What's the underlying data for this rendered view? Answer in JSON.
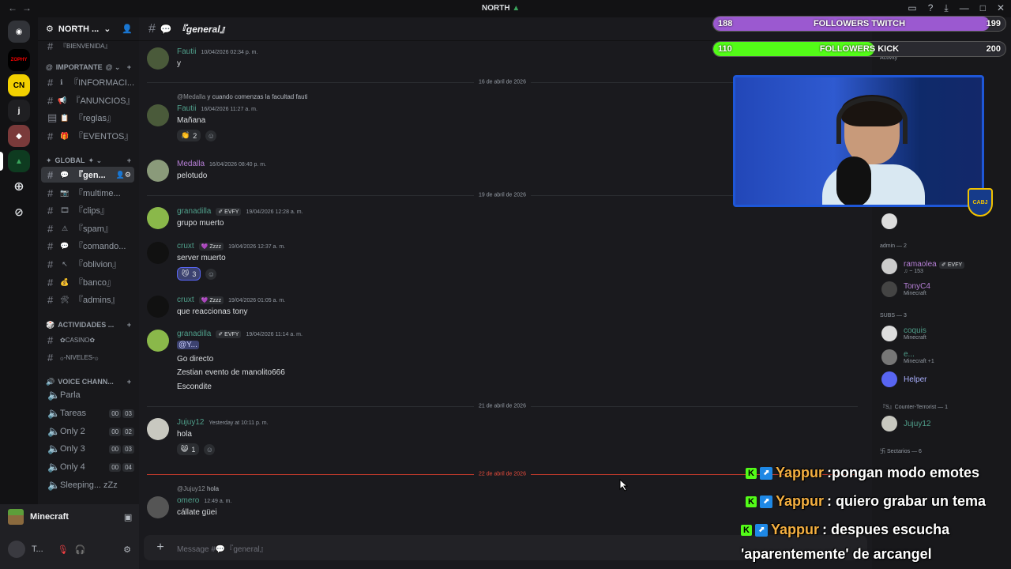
{
  "titlebar": {
    "title": "NORTH",
    "leaf": "▲"
  },
  "server": {
    "name": "NORTH ...",
    "categories": {
      "importante": "IMPORTANTE",
      "global": "GLOBAL",
      "actividades": "ACTIVIDADES ...",
      "voice": "VOICE CHANN..."
    },
    "top_channel": "『BIENVENIDA』",
    "channels_importante": [
      {
        "label": "『INFORMACI...",
        "emoji": "ℹ"
      },
      {
        "label": "『ANUNCIOS』",
        "emoji": "📢"
      },
      {
        "label": "『reglas』",
        "emoji": "📋"
      },
      {
        "label": "『EVENTOS』",
        "emoji": "🎁"
      }
    ],
    "channels_global": [
      {
        "label": "『gen...",
        "emoji": "💬"
      },
      {
        "label": "『multime...",
        "emoji": "📷"
      },
      {
        "label": "『clips』",
        "emoji": "🎞"
      },
      {
        "label": "『spam』",
        "emoji": "⚠"
      },
      {
        "label": "『comando...",
        "emoji": "💬"
      },
      {
        "label": "『oblivion』",
        "emoji": "↖"
      },
      {
        "label": "『banco』",
        "emoji": "💰"
      },
      {
        "label": "『admins』",
        "emoji": "🛠"
      }
    ],
    "channels_actividades": [
      "✿CASINO✿",
      "۞-NIVELES-۞"
    ],
    "voice_channels": [
      {
        "label": "Parla",
        "a": "",
        "b": ""
      },
      {
        "label": "Tareas",
        "a": "00",
        "b": "03"
      },
      {
        "label": "Only 2",
        "a": "00",
        "b": "02"
      },
      {
        "label": "Only 3",
        "a": "00",
        "b": "03"
      },
      {
        "label": "Only 4",
        "a": "00",
        "b": "04"
      },
      {
        "label": "Sleeping... zZz",
        "a": "",
        "b": ""
      }
    ]
  },
  "userpanel": {
    "activity": "Minecraft",
    "user": "T...",
    "status": "M"
  },
  "chat": {
    "channel": "『general』",
    "composer_placeholder": "Message #💬『general』",
    "messages": [
      {
        "user": "Fautii",
        "time": "10/04/2026 02:34 p. m.",
        "text": "y"
      },
      {
        "date": "16 de abril de 2026"
      },
      {
        "reply_user": "@Medalla",
        "reply_text": "y cuando comenzas la facultad fauti",
        "user": "Fautii",
        "time": "16/04/2026 11:27 a. m.",
        "text": "Mañana",
        "reaction": "2"
      },
      {
        "user": "Medalla",
        "time": "16/04/2026 08:40 p. m.",
        "text": "pelotudo"
      },
      {
        "date": "19 de abril de 2026"
      },
      {
        "user": "granadilla",
        "tag": "✐ EVFY",
        "time": "19/04/2026 12:28 a. m.",
        "text": "grupo muerto"
      },
      {
        "user": "cruxt",
        "tag": "💜 Zzzz",
        "time": "19/04/2026 12:37 a. m.",
        "text": "server muerto",
        "reaction": "3"
      },
      {
        "user": "cruxt",
        "tag": "💜 Zzzz",
        "time": "19/04/2026 01:05 a. m.",
        "text": "que reaccionas tony"
      },
      {
        "user": "granadilla",
        "tag": "✐ EVFY",
        "time": "19/04/2026 11:14 a. m.",
        "mention": "@Y...",
        "lines": [
          "Go directo",
          "Zestian evento de manolito666",
          "Escondite"
        ]
      },
      {
        "date": "21 de abril de 2026"
      },
      {
        "user": "Jujuy12",
        "time": "Yesterday at 10:11 p. m.",
        "text": "hola",
        "reaction": "1"
      },
      {
        "date": "22 de abril de 2026"
      },
      {
        "reply_user": "@Jujuy12",
        "reply_text": "hola",
        "user": "omero",
        "time": "12:49 a. m.",
        "text": "cállate güei"
      }
    ]
  },
  "members": {
    "groups": [
      "admin — 2",
      "SUBS — 3",
      "『S』Counter-Terrorist — 1",
      "卐 Sectarios — 6"
    ],
    "list": [
      {
        "name": "ramaolea",
        "tag": "✐ EVFY",
        "act": "♫ ~ 153"
      },
      {
        "name": "TonyC4",
        "act": "Minecraft"
      },
      {
        "name": "coquis",
        "act": "Minecraft"
      },
      {
        "name": "e...",
        "act": "Minecraft +1"
      },
      {
        "name": "Helper",
        "act": ""
      },
      {
        "name": "Jujuy12",
        "act": ""
      }
    ],
    "top_activity": "Activity"
  },
  "overlay": {
    "twitch": {
      "current": "188",
      "label": "FOLLOWERS TWITCH",
      "goal": "199",
      "progress": 0.945
    },
    "kick": {
      "current": "110",
      "label": "FOLLOWERS KICK",
      "goal": "200",
      "progress": 0.55
    },
    "badge": "CABJ",
    "chat": [
      {
        "who": "Yappur",
        "text": ":pongan modo emotes"
      },
      {
        "who": "Yappur",
        "text": ": quiero grabar un tema"
      },
      {
        "who": "Yappur",
        "text": ": despues escucha"
      },
      {
        "who": "",
        "text": "'aparentemente' de arcangel"
      }
    ]
  },
  "colors": {
    "twitch_fill": "#9b59d0",
    "kick_fill": "#53fc18",
    "accent": "#5865f2"
  }
}
